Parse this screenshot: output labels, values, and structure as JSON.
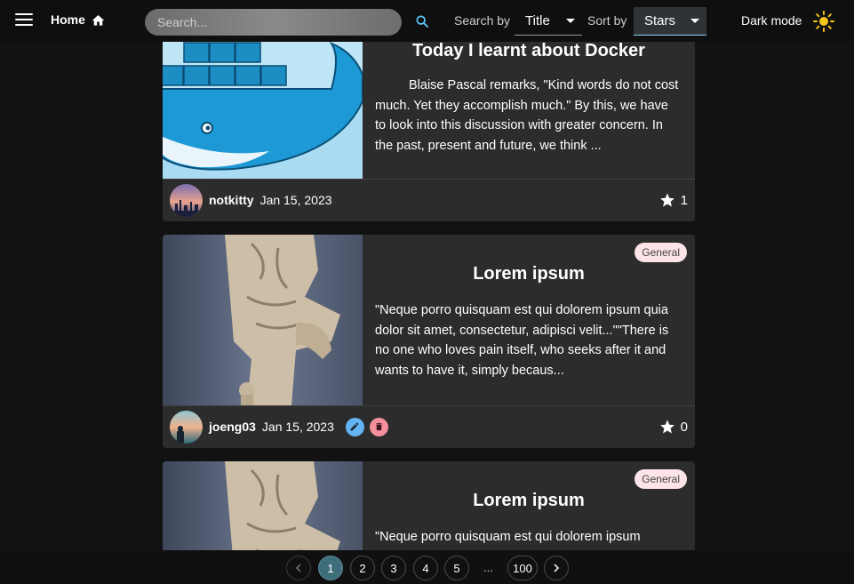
{
  "header": {
    "home_label": "Home",
    "search_placeholder": "Search...",
    "search_by_label": "Search by",
    "search_by_value": "Title",
    "sort_by_label": "Sort by",
    "sort_by_value": "Stars",
    "dark_mode_label": "Dark mode"
  },
  "posts": [
    {
      "title": "Today I learnt about Docker",
      "excerpt": "Blaise Pascal remarks, \"Kind words do not cost much. Yet they accomplish much.\" By this, we have to look into this discussion with greater concern. In the past, present and future, we think ...",
      "author": "notkitty",
      "date": "Jan 15, 2023",
      "stars": "1"
    },
    {
      "badge": "General",
      "title": "Lorem ipsum",
      "excerpt": "\"Neque porro quisquam est qui dolorem ipsum quia dolor sit amet, consectetur, adipisci velit...\"\"There is no one who loves pain itself, who seeks after it and wants to have it, simply becaus...",
      "author": "joeng03",
      "date": "Jan 15, 2023",
      "stars": "0"
    },
    {
      "badge": "General",
      "title": "Lorem ipsum",
      "excerpt": "\"Neque porro quisquam est qui dolorem ipsum"
    }
  ],
  "pagination": {
    "pages": [
      "1",
      "2",
      "3",
      "4",
      "5"
    ],
    "ellipsis": "...",
    "last": "100",
    "current": "1"
  },
  "colors": {
    "accent": "#3e6e79",
    "badge_bg": "#fde4e9",
    "edit_button": "#64b5f6",
    "delete_button": "#f48f9b"
  },
  "icons": [
    "menu-icon",
    "home-icon",
    "search-icon",
    "sun-icon",
    "star-icon",
    "pencil-icon",
    "trash-icon",
    "chevron-left-icon",
    "chevron-right-icon"
  ]
}
